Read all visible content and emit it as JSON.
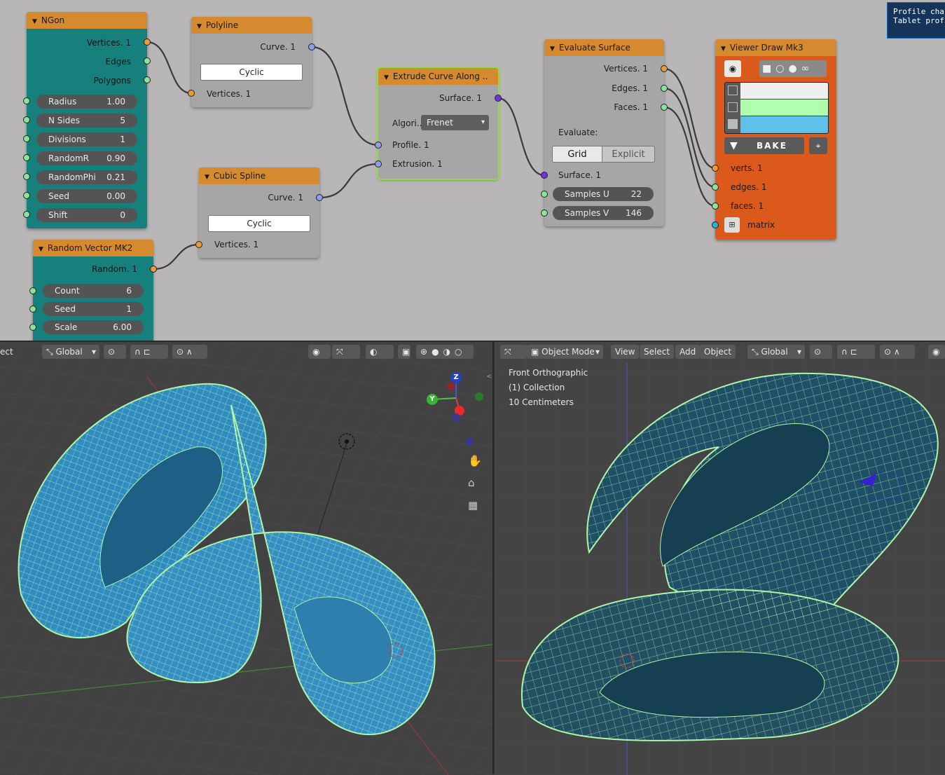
{
  "tooltip": {
    "line1": "Profile cha",
    "line2": "Tablet prof"
  },
  "nodes": {
    "ngon": {
      "title": "NGon",
      "outputs": [
        "Vertices. 1",
        "Edges",
        "Polygons"
      ],
      "fields": [
        {
          "label": "Radius",
          "value": "1.00"
        },
        {
          "label": "N Sides",
          "value": "5"
        },
        {
          "label": "Divisions",
          "value": "1"
        },
        {
          "label": "RandomR",
          "value": "0.90"
        },
        {
          "label": "RandomPhi",
          "value": "0.21"
        },
        {
          "label": "Seed",
          "value": "0.00"
        },
        {
          "label": "Shift",
          "value": "0"
        }
      ]
    },
    "polyline": {
      "title": "Polyline",
      "output": "Curve. 1",
      "button": "Cyclic",
      "input": "Vertices. 1"
    },
    "cubic": {
      "title": "Cubic Spline",
      "output": "Curve. 1",
      "button": "Cyclic",
      "input": "Vertices. 1"
    },
    "random": {
      "title": "Random Vector MK2",
      "output": "Random. 1",
      "fields": [
        {
          "label": "Count",
          "value": "6"
        },
        {
          "label": "Seed",
          "value": "1"
        },
        {
          "label": "Scale",
          "value": "6.00"
        }
      ]
    },
    "extrude": {
      "title": "Extrude Curve Along ..",
      "output": "Surface. 1",
      "algo_label": "Algori..",
      "algo_value": "Frenet",
      "inputs": [
        "Profile. 1",
        "Extrusion. 1"
      ]
    },
    "evaluate": {
      "title": "Evaluate Surface",
      "outputs": [
        "Vertices. 1",
        "Edges. 1",
        "Faces. 1"
      ],
      "evaluate_label": "Evaluate:",
      "grid": "Grid",
      "explicit": "Explicit",
      "input": "Surface. 1",
      "fields": [
        {
          "label": "Samples U",
          "value": "22"
        },
        {
          "label": "Samples V",
          "value": "146"
        }
      ]
    },
    "viewer": {
      "title": "Viewer Draw Mk3",
      "bake": "BAKE",
      "inputs": [
        "verts. 1",
        "edges. 1",
        "faces. 1",
        "matrix"
      ],
      "colors": {
        "verts": "#eeeeee",
        "edges": "#aeffae",
        "faces": "#5fc0ea"
      }
    }
  },
  "left_header": {
    "mode_text": "ect",
    "orientation": "Global"
  },
  "right_header": {
    "mode": "Object Mode",
    "view": "View",
    "select": "Select",
    "add": "Add",
    "object": "Object",
    "orientation": "Global"
  },
  "right_overlay": {
    "view_name": "Front Orthographic",
    "collection": "(1) Collection",
    "scale": "10 Centimeters"
  },
  "gizmo": {
    "z": "Z",
    "y": "Y"
  },
  "colors": {
    "node_header": "#d58a2f",
    "teal_body": "#16807d",
    "viewer_body": "#db5a1b",
    "mesh": "#2f8bc0",
    "wire": "#aef5a8"
  }
}
